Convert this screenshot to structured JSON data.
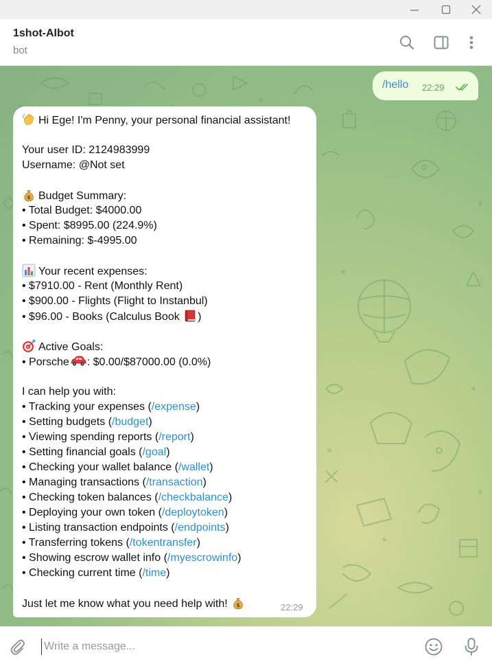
{
  "chat": {
    "title": "1shot-AIbot",
    "subtitle": "bot"
  },
  "outgoing": {
    "text": "/hello",
    "time": "22:29"
  },
  "incoming": {
    "time": "22:29",
    "greeting": "Hi Ege! I'm Penny, your personal financial assistant!",
    "user_id": "Your user ID: 2124983999",
    "username": "Username: @Not set",
    "budget": {
      "heading": "Budget Summary:",
      "lines": [
        "• Total Budget: $4000.00",
        "• Spent: $8995.00 (224.9%)",
        "• Remaining: $-4995.00"
      ]
    },
    "expenses": {
      "heading": "Your recent expenses:",
      "lines": [
        "• $7910.00 - Rent (Monthly Rent)",
        "• $900.00 - Flights (Flight to Instanbul)"
      ],
      "last": "• $96.00 - Books (Calculus Book ",
      "last_end": ")"
    },
    "goals": {
      "heading": "Active Goals:",
      "pre": "• Porsche",
      "post": ": $0.00/$87000.00 (0.0%)"
    },
    "help_intro": "I can help you with:",
    "help_items": [
      {
        "label": "• Tracking your expenses (",
        "cmd": "/expense",
        "end": ")"
      },
      {
        "label": "• Setting budgets (",
        "cmd": "/budget",
        "end": ")"
      },
      {
        "label": "• Viewing spending reports (",
        "cmd": "/report",
        "end": ")"
      },
      {
        "label": "• Setting financial goals (",
        "cmd": "/goal",
        "end": ")"
      },
      {
        "label": "• Checking your wallet balance (",
        "cmd": "/wallet",
        "end": ")"
      },
      {
        "label": "• Managing transactions (",
        "cmd": "/transaction",
        "end": ")"
      },
      {
        "label": "• Checking token balances (",
        "cmd": "/checkbalance",
        "end": ")"
      },
      {
        "label": "• Deploying your own token (",
        "cmd": "/deploytoken",
        "end": ")"
      },
      {
        "label": "• Listing transaction endpoints (",
        "cmd": "/endpoints",
        "end": ")"
      },
      {
        "label": "• Transferring tokens (",
        "cmd": "/tokentransfer",
        "end": ")"
      },
      {
        "label": "• Showing escrow wallet info (",
        "cmd": "/myescrowinfo",
        "end": ")"
      },
      {
        "label": "• Checking current time (",
        "cmd": "/time",
        "end": ")"
      }
    ],
    "closing": "Just let me know what you need help with! "
  },
  "composer": {
    "placeholder": "Write a message..."
  },
  "icons": {
    "window": [
      "minimize-icon",
      "maximize-icon",
      "close-icon"
    ],
    "header": [
      "search-icon",
      "sidebar-toggle-icon",
      "more-vertical-icon"
    ],
    "message": [
      "waving-hand-icon",
      "money-bag-icon",
      "bar-chart-icon",
      "book-icon",
      "target-icon",
      "car-icon",
      "double-check-icon"
    ],
    "composer": [
      "attach-icon",
      "emoji-icon",
      "microphone-icon"
    ]
  },
  "colors": {
    "link": "#2d8fd0",
    "outgoing_bubble": "#effdde",
    "outgoing_link": "#3a8fc7",
    "outgoing_time": "#5fab4e",
    "chat_bg_start": "#86b284",
    "chat_bg_end": "#d5d99a"
  }
}
